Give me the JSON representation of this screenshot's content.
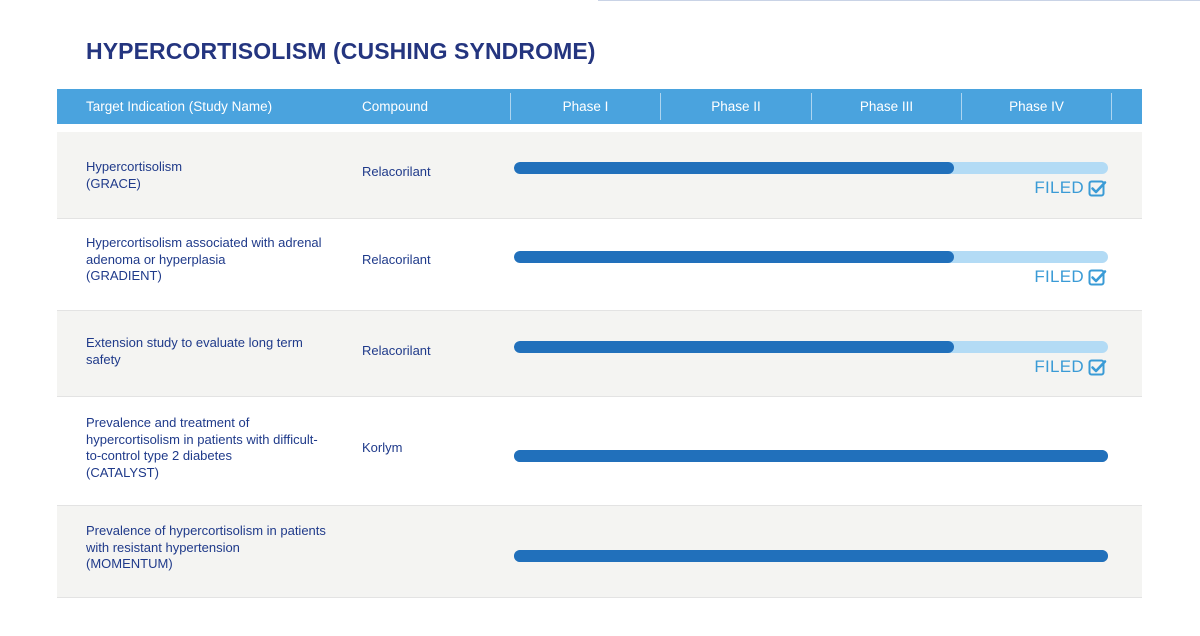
{
  "title": "HYPERCORTISOLISM (CUSHING SYNDROME)",
  "header": {
    "indication": "Target Indication (Study Name)",
    "compound": "Compound",
    "phases": [
      "Phase I",
      "Phase II",
      "Phase III",
      "Phase IV"
    ]
  },
  "colors": {
    "title": "#24357f",
    "header_bg": "#4aa3de",
    "progress_fill": "#2170bb",
    "progress_track": "#b3dbf5",
    "filed": "#3a9bd6"
  },
  "rows": [
    {
      "indication": [
        "Hypercortisolism",
        "(GRACE)"
      ],
      "compound": "Relacorilant",
      "progress": 0.74,
      "status": "FILED",
      "status_icon": "checkbox-checked-icon"
    },
    {
      "indication": [
        "Hypercortisolism associated with adrenal",
        "adenoma or hyperplasia",
        "(GRADIENT)"
      ],
      "compound": "Relacorilant",
      "progress": 0.74,
      "status": "FILED",
      "status_icon": "checkbox-checked-icon"
    },
    {
      "indication": [
        "Extension study to evaluate long term",
        "safety"
      ],
      "compound": "Relacorilant",
      "progress": 0.74,
      "status": "FILED",
      "status_icon": "checkbox-checked-icon"
    },
    {
      "indication": [
        "Prevalence and treatment of",
        "hypercortisolism in patients with difficult-",
        "to-control type 2 diabetes",
        "(CATALYST)"
      ],
      "compound": "Korlym",
      "progress": 1.0,
      "status": "",
      "status_icon": ""
    },
    {
      "indication": [
        "Prevalence of hypercortisolism in patients",
        "with resistant hypertension",
        "(MOMENTUM)"
      ],
      "compound": "",
      "progress": 1.0,
      "status": "",
      "status_icon": ""
    }
  ]
}
